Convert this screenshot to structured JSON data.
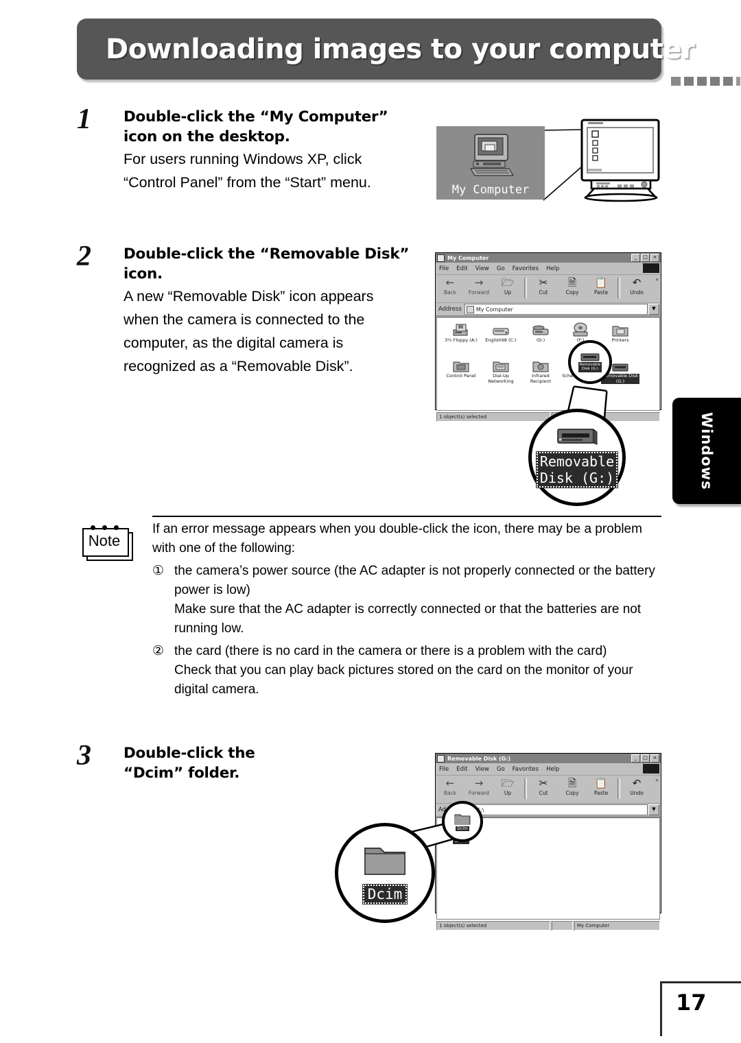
{
  "header": {
    "title": "Downloading images to your computer",
    "dash_count": 6
  },
  "side_tab": {
    "label": "Windows"
  },
  "steps": [
    {
      "number": "1",
      "heading_lines": [
        "Double-click the “My Computer”",
        "icon on the desktop."
      ],
      "body_lines": [
        "For users running Windows XP, click",
        "“Control Panel” from the “Start” menu."
      ]
    },
    {
      "number": "2",
      "heading_lines": [
        "Double-click the “Removable Disk”",
        "icon."
      ],
      "body_lines": [
        "A new “Removable Disk” icon appears",
        "when the camera is connected to the",
        "computer, as the digital camera is",
        "recognized as a “Removable Disk”."
      ]
    },
    {
      "number": "3",
      "heading_lines": [
        "Double-click the",
        "“Dcim” folder."
      ],
      "body_lines": []
    }
  ],
  "desktop_illustration": {
    "icon_label": "My Computer",
    "icon_name": "my-computer-desktop-icon",
    "monitor_name": "crt-monitor"
  },
  "window_mycomputer": {
    "title": "My Computer",
    "menu": [
      "File",
      "Edit",
      "View",
      "Go",
      "Favorites",
      "Help"
    ],
    "toolbar": [
      "Back",
      "Forward",
      "Up",
      "Cut",
      "Copy",
      "Paste",
      "Undo"
    ],
    "address_label": "Address",
    "address_value": "My Computer",
    "icons": [
      "3½ Floppy (A:)",
      "English98 (C:)",
      "(D:)",
      "(F:)",
      "Printers",
      "Control Panel",
      "Dial-Up Networking",
      "Infrared Recipient",
      "Scheduled Tasks",
      "Removable Disk (G:)"
    ],
    "status_left": "1 object(s) selected",
    "titlebar_buttons": [
      "_",
      "□",
      "×"
    ]
  },
  "callout_removable": {
    "line1": "Removable",
    "line2": "Disk (G:)"
  },
  "window_removable": {
    "title": "Removable Disk (G:)",
    "menu": [
      "File",
      "Edit",
      "View",
      "Go",
      "Favorites",
      "Help"
    ],
    "toolbar": [
      "Back",
      "Forward",
      "Up",
      "Cut",
      "Copy",
      "Paste",
      "Undo"
    ],
    "address_label": "Address",
    "address_value": "G:\\",
    "icons": [
      "Dcim"
    ],
    "status_left": "1 object(s) selected",
    "status_right": "My Computer",
    "titlebar_buttons": [
      "_",
      "□",
      "×"
    ]
  },
  "callout_dcim": {
    "label": "Dcim"
  },
  "note": {
    "icon_label": "Note",
    "paragraph": "If an error message appears when you double-click the icon, there may be a problem with one of the following:",
    "items": [
      {
        "marker": "①",
        "text": "the camera’s power source (the AC adapter is not properly connected or the battery power is low)",
        "follow": "Make sure that the AC adapter is correctly connected or that the batteries are not running low."
      },
      {
        "marker": "②",
        "text": "the card (there is no card in the camera or there is a problem with the card)",
        "follow": "Check that you can play back pictures stored on the card on the monitor of your digital camera."
      }
    ]
  },
  "footer": {
    "page_number": "17"
  },
  "colors": {
    "header_bg": "#565656",
    "window_chrome": "#c0c0c0",
    "titlebar": "#808080",
    "tab_bg": "#000000",
    "dash": "#7d7d7d"
  }
}
